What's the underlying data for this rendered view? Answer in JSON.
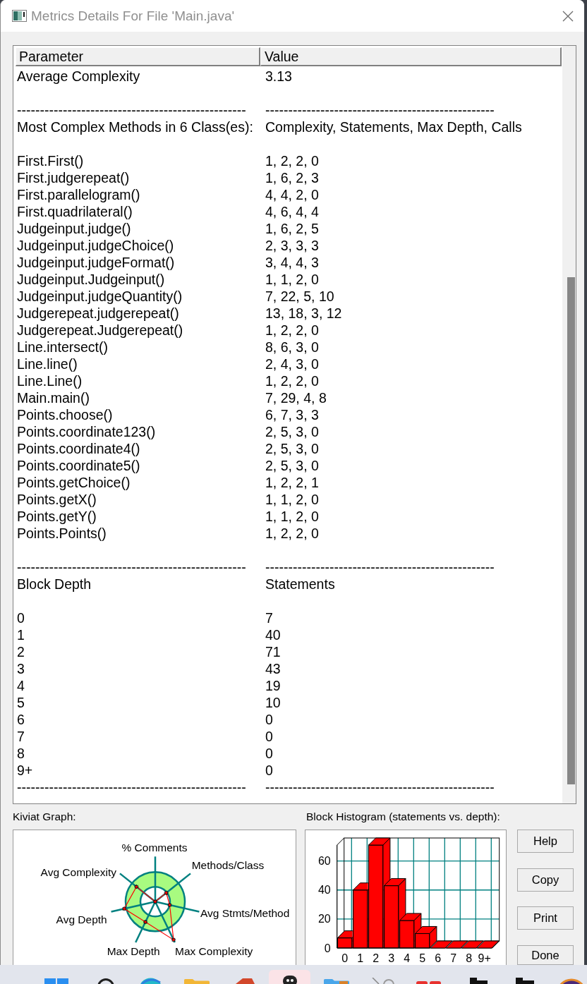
{
  "window": {
    "title": "Metrics Details For File 'Main.java'"
  },
  "table": {
    "columns": [
      "Parameter",
      "Value"
    ],
    "rows": [
      {
        "kind": "text",
        "parameter": "Average Complexity",
        "value": "3.13"
      },
      {
        "kind": "blank"
      },
      {
        "kind": "text",
        "parameter": "--------------------------------------------------",
        "value": "--------------------------------------------------"
      },
      {
        "kind": "text",
        "parameter": "Most Complex Methods in 6 Class(es):",
        "value": "Complexity, Statements, Max Depth, Calls"
      },
      {
        "kind": "blank"
      },
      {
        "kind": "text",
        "parameter": "First.First()",
        "value": "1, 2, 2, 0"
      },
      {
        "kind": "text",
        "parameter": "First.judgerepeat()",
        "value": "1, 6, 2, 3"
      },
      {
        "kind": "text",
        "parameter": "First.parallelogram()",
        "value": "4, 4, 2, 0"
      },
      {
        "kind": "text",
        "parameter": "First.quadrilateral()",
        "value": "4, 6, 4, 4"
      },
      {
        "kind": "text",
        "parameter": "Judgeinput.judge()",
        "value": "1, 6, 2, 5"
      },
      {
        "kind": "text",
        "parameter": "Judgeinput.judgeChoice()",
        "value": "2, 3, 3, 3"
      },
      {
        "kind": "text",
        "parameter": "Judgeinput.judgeFormat()",
        "value": "3, 4, 4, 3"
      },
      {
        "kind": "text",
        "parameter": "Judgeinput.Judgeinput()",
        "value": "1, 1, 2, 0"
      },
      {
        "kind": "text",
        "parameter": "Judgeinput.judgeQuantity()",
        "value": "7, 22, 5, 10"
      },
      {
        "kind": "text",
        "parameter": "Judgerepeat.judgerepeat()",
        "value": "13, 18, 3, 12"
      },
      {
        "kind": "text",
        "parameter": "Judgerepeat.Judgerepeat()",
        "value": "1, 2, 2, 0"
      },
      {
        "kind": "text",
        "parameter": "Line.intersect()",
        "value": "8, 6, 3, 0"
      },
      {
        "kind": "text",
        "parameter": "Line.line()",
        "value": "2, 4, 3, 0"
      },
      {
        "kind": "text",
        "parameter": "Line.Line()",
        "value": "1, 2, 2, 0"
      },
      {
        "kind": "text",
        "parameter": "Main.main()",
        "value": "7, 29, 4, 8"
      },
      {
        "kind": "text",
        "parameter": "Points.choose()",
        "value": "6, 7, 3, 3"
      },
      {
        "kind": "text",
        "parameter": "Points.coordinate123()",
        "value": "2, 5, 3, 0"
      },
      {
        "kind": "text",
        "parameter": "Points.coordinate4()",
        "value": "2, 5, 3, 0"
      },
      {
        "kind": "text",
        "parameter": "Points.coordinate5()",
        "value": "2, 5, 3, 0"
      },
      {
        "kind": "text",
        "parameter": "Points.getChoice()",
        "value": "1, 2, 2, 1"
      },
      {
        "kind": "text",
        "parameter": "Points.getX()",
        "value": "1, 1, 2, 0"
      },
      {
        "kind": "text",
        "parameter": "Points.getY()",
        "value": "1, 1, 2, 0"
      },
      {
        "kind": "text",
        "parameter": "Points.Points()",
        "value": "1, 2, 2, 0"
      },
      {
        "kind": "blank"
      },
      {
        "kind": "text",
        "parameter": "--------------------------------------------------",
        "value": "--------------------------------------------------"
      },
      {
        "kind": "text",
        "parameter": "Block Depth",
        "value": "Statements"
      },
      {
        "kind": "blank"
      },
      {
        "kind": "text",
        "parameter": "0",
        "value": "7"
      },
      {
        "kind": "text",
        "parameter": "1",
        "value": "40"
      },
      {
        "kind": "text",
        "parameter": "2",
        "value": "71"
      },
      {
        "kind": "text",
        "parameter": "3",
        "value": "43"
      },
      {
        "kind": "text",
        "parameter": "4",
        "value": "19"
      },
      {
        "kind": "text",
        "parameter": "5",
        "value": "10"
      },
      {
        "kind": "text",
        "parameter": "6",
        "value": "0"
      },
      {
        "kind": "text",
        "parameter": "7",
        "value": "0"
      },
      {
        "kind": "text",
        "parameter": "8",
        "value": "0"
      },
      {
        "kind": "text",
        "parameter": "9+",
        "value": "0"
      },
      {
        "kind": "text",
        "parameter": "--------------------------------------------------",
        "value": "--------------------------------------------------"
      }
    ]
  },
  "kiviat": {
    "title": "Kiviat Graph:",
    "axes": [
      "% Comments",
      "Methods/Class",
      "Avg Complexity",
      "Avg Stmts/Method",
      "Avg Depth",
      "Max Depth",
      "Max Complexity"
    ]
  },
  "histogram": {
    "chart_data": {
      "type": "bar",
      "title": "Block Histogram (statements vs. depth):",
      "categories": [
        "0",
        "1",
        "2",
        "3",
        "4",
        "5",
        "6",
        "7",
        "8",
        "9+"
      ],
      "values": [
        7,
        40,
        71,
        43,
        19,
        10,
        0,
        0,
        0,
        0
      ],
      "ylim": [
        0,
        71
      ],
      "yticks": [
        0,
        20,
        40,
        60
      ],
      "grid": true
    }
  },
  "buttons": [
    "Help",
    "Copy",
    "Print",
    "Done"
  ],
  "taskbar": {
    "items": [
      {
        "selected": false
      },
      {
        "selected": false
      },
      {
        "selected": false
      },
      {
        "selected": false
      },
      {
        "selected": false
      },
      {
        "selected": true
      },
      {
        "selected": false
      },
      {
        "selected": false
      },
      {
        "selected": false
      },
      {
        "selected": false
      },
      {
        "selected": false
      },
      {
        "selected": false
      }
    ]
  }
}
